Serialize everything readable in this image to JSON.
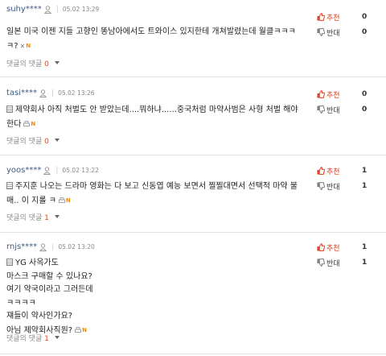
{
  "labels": {
    "reply_prefix": "댓글의 댓글",
    "up": "추천",
    "down": "반대"
  },
  "comments": [
    {
      "user": "suhy****",
      "time": "05.02 13:29",
      "lines": [
        "일본 미국 이젠 지들 고향인 똥남아에서도 트와이스 있지한테 개쳐발렸는데 월클ㅋㅋㅋ",
        "ㅋ?"
      ],
      "reply_count": "0",
      "up": "0",
      "down": "0"
    },
    {
      "user": "tasi****",
      "time": "05.02 13:26",
      "lines": [
        "제약회사 아직 처벌도 안 받았는데....뭐하냐......중국처럼 마약사범은 사형 처벌 해야",
        "한다"
      ],
      "reply_count": "0",
      "up": "0",
      "down": "0"
    },
    {
      "user": "yoos****",
      "time": "05.02 13:22",
      "lines": [
        "주지훈 나오는 드라마 영화는 다 보고 신동엽 예능 보면서 찔찔대면서 선택적 마약 불",
        "매.. 이 지롤 ㅋ"
      ],
      "reply_count": "1",
      "up": "1",
      "down": "1"
    },
    {
      "user": "rnjs****",
      "time": "05.02 13:20",
      "lines": [
        "YG 사옥가도",
        "마스크 구매할 수 있나요?",
        "여기 약국이라고 그러든데",
        "ㅋㅋㅋㅋ",
        "쟤들이 약사인가요?",
        "아님 제약회사직원?"
      ],
      "reply_count": "1",
      "up": "1",
      "down": "1"
    }
  ]
}
